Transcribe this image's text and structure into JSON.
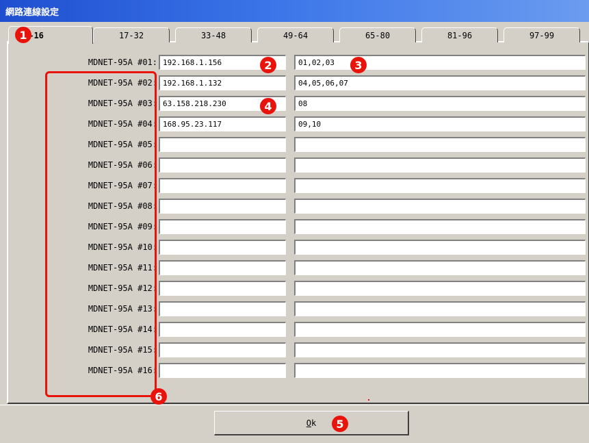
{
  "window": {
    "title": "網路連線設定"
  },
  "tabs": [
    {
      "label": "1-16",
      "active": true
    },
    {
      "label": "17-32",
      "active": false
    },
    {
      "label": "33-48",
      "active": false
    },
    {
      "label": "49-64",
      "active": false
    },
    {
      "label": "65-80",
      "active": false
    },
    {
      "label": "81-96",
      "active": false
    },
    {
      "label": "97-99",
      "active": false
    }
  ],
  "rows": [
    {
      "label": "MDNET-95A #01:",
      "ip": "192.168.1.156",
      "channels": "01,02,03"
    },
    {
      "label": "MDNET-95A #02:",
      "ip": "192.168.1.132",
      "channels": "04,05,06,07"
    },
    {
      "label": "MDNET-95A #03:",
      "ip": "63.158.218.230",
      "channels": "08"
    },
    {
      "label": "MDNET-95A #04:",
      "ip": "168.95.23.117",
      "channels": "09,10"
    },
    {
      "label": "MDNET-95A #05:",
      "ip": "",
      "channels": ""
    },
    {
      "label": "MDNET-95A #06:",
      "ip": "",
      "channels": ""
    },
    {
      "label": "MDNET-95A #07:",
      "ip": "",
      "channels": ""
    },
    {
      "label": "MDNET-95A #08:",
      "ip": "",
      "channels": ""
    },
    {
      "label": "MDNET-95A #09:",
      "ip": "",
      "channels": ""
    },
    {
      "label": "MDNET-95A #10:",
      "ip": "",
      "channels": ""
    },
    {
      "label": "MDNET-95A #11:",
      "ip": "",
      "channels": ""
    },
    {
      "label": "MDNET-95A #12:",
      "ip": "",
      "channels": ""
    },
    {
      "label": "MDNET-95A #13:",
      "ip": "",
      "channels": ""
    },
    {
      "label": "MDNET-95A #14:",
      "ip": "",
      "channels": ""
    },
    {
      "label": "MDNET-95A #15:",
      "ip": "",
      "channels": ""
    },
    {
      "label": "MDNET-95A #16:",
      "ip": "",
      "channels": ""
    }
  ],
  "ok_button": {
    "mnemonic": "O",
    "rest": "k"
  },
  "callouts": [
    "1",
    "2",
    "3",
    "4",
    "5",
    "6"
  ],
  "colors": {
    "callout": "#e8140c",
    "title_bar": "#1f4fd0"
  }
}
